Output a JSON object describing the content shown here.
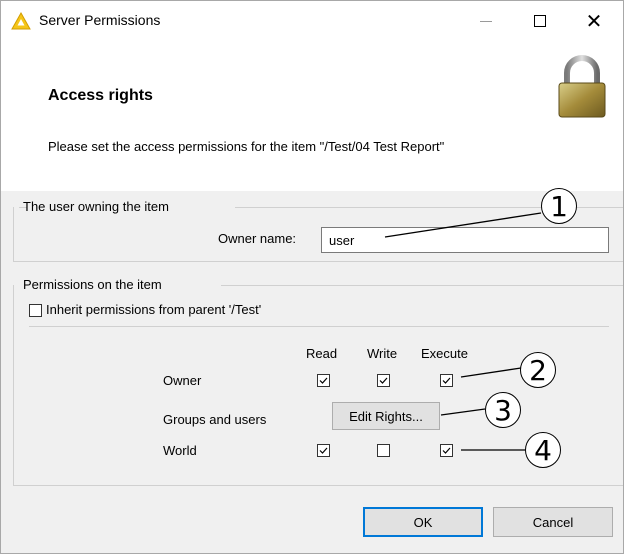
{
  "window": {
    "title": "Server Permissions",
    "accent": "#0078d7"
  },
  "banner": {
    "title": "Access rights",
    "message": "Please set the access permissions for the item  \"/Test/04 Test Report\""
  },
  "owner_group": {
    "title": "The user owning the item",
    "owner_label": "Owner name:",
    "owner_value": "user"
  },
  "permissions_group": {
    "title": "Permissions on the item",
    "inherit_label": "Inherit permissions from parent '/Test'",
    "inherit_checked": false,
    "columns": [
      "Read",
      "Write",
      "Execute"
    ],
    "rows": {
      "owner": {
        "label": "Owner",
        "read": true,
        "write": true,
        "execute": true
      },
      "groups": {
        "label": "Groups and users",
        "button": "Edit Rights..."
      },
      "world": {
        "label": "World",
        "read": true,
        "write": false,
        "execute": true
      }
    }
  },
  "buttons": {
    "ok": "OK",
    "cancel": "Cancel"
  },
  "callouts": [
    "1",
    "2",
    "3",
    "4"
  ]
}
